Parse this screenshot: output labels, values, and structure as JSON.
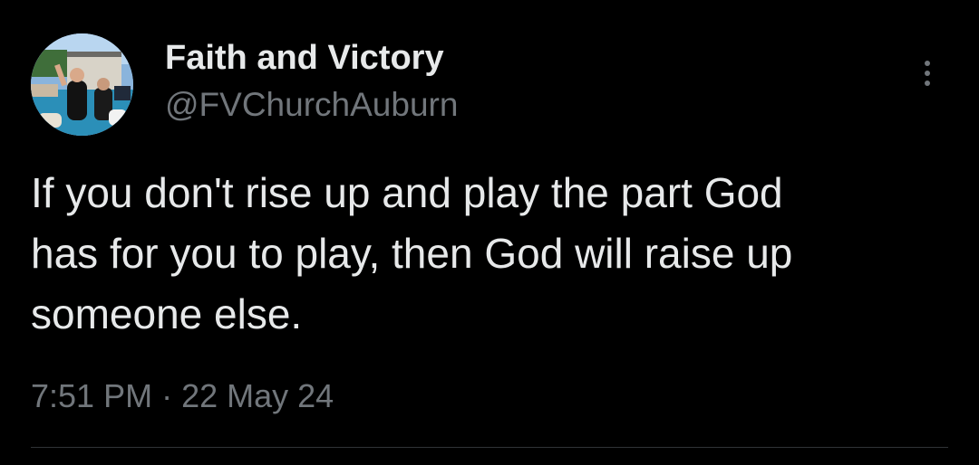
{
  "tweet": {
    "author": {
      "display_name": "Faith and Victory",
      "handle": "@FVChurchAuburn",
      "avatar_icon": "baptism-photo-avatar"
    },
    "menu_icon": "more-vertical-icon",
    "text": "If you don't rise up and play the part God\nhas for you to play, then God will raise up\nsomeone else.",
    "time": "7:51 PM",
    "separator": "·",
    "date": "22 May 24"
  },
  "colors": {
    "background": "#000000",
    "primary_text": "#e7e9ea",
    "secondary_text": "#71767b",
    "divider": "#2f3336"
  }
}
